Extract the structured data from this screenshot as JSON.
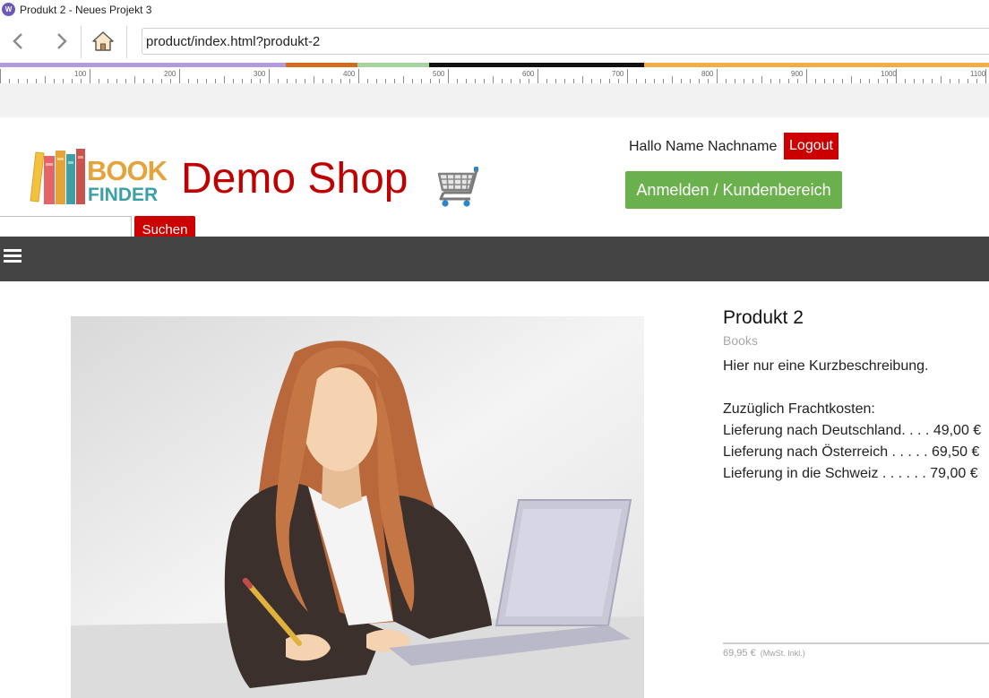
{
  "window": {
    "title": "Produkt 2 - Neues Projekt 3",
    "app_icon_text": "W"
  },
  "nav": {
    "url": "product/index.html?produkt-2"
  },
  "ruler": {
    "labels": [
      "100",
      "200",
      "300",
      "400",
      "500",
      "600",
      "700",
      "800",
      "900",
      "1000",
      "1100"
    ]
  },
  "colors": {
    "brand_red": "#c00000",
    "button_red": "#cc0000",
    "account_green": "#6ab04c",
    "menubar_gray": "#444444",
    "strip": [
      "#b399df",
      "#d26a20",
      "#a6d4a0",
      "#111111",
      "#f3ac48"
    ]
  },
  "header": {
    "logo_line1": "BOOK",
    "logo_line2": "FINDER",
    "shop_title": "Demo Shop",
    "greeting": "Hallo Name Nachname",
    "logout_label": "Logout",
    "account_label": "Anmelden / Kundenbereich",
    "search_value": "",
    "search_button": "Suchen"
  },
  "icons": {
    "back": "chevron-left-icon",
    "forward": "chevron-right-icon",
    "home": "home-icon",
    "cart": "shopping-cart-icon",
    "menu": "hamburger-menu-icon"
  },
  "product": {
    "name": "Produkt 2",
    "category": "Books",
    "short_description": "Hier nur eine Kurzbeschreibung.",
    "shipping_title": "Zuzüglich Frachtkosten:",
    "shipping": [
      "Lieferung nach Deutschland. . . . 49,00 €",
      "Lieferung nach Österreich . . . . . 69,50 €",
      "Lieferung in die Schweiz . . . . . . 79,00 €"
    ],
    "price": "69,95 €",
    "price_note": "(MwSt. Inkl.)"
  }
}
